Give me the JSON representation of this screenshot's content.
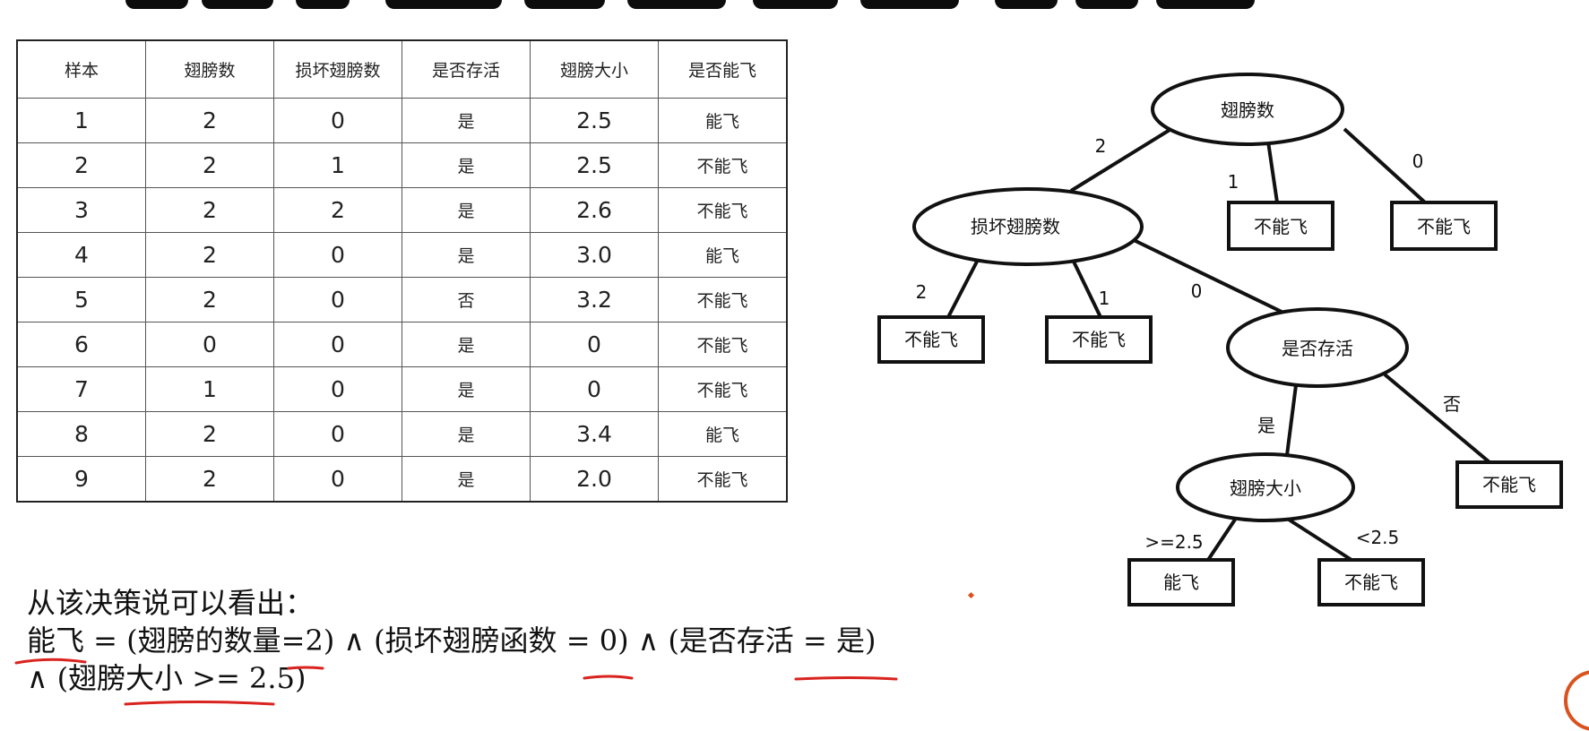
{
  "table": {
    "headers": [
      "样本",
      "翅膀数",
      "损坏翅膀数",
      "是否存活",
      "翅膀大小",
      "是否能飞"
    ],
    "rows": [
      [
        "1",
        "2",
        "0",
        "是",
        "2.5",
        "能飞"
      ],
      [
        "2",
        "2",
        "1",
        "是",
        "2.5",
        "不能飞"
      ],
      [
        "3",
        "2",
        "2",
        "是",
        "2.6",
        "不能飞"
      ],
      [
        "4",
        "2",
        "0",
        "是",
        "3.0",
        "能飞"
      ],
      [
        "5",
        "2",
        "0",
        "否",
        "3.2",
        "不能飞"
      ],
      [
        "6",
        "0",
        "0",
        "是",
        "0",
        "不能飞"
      ],
      [
        "7",
        "1",
        "0",
        "是",
        "0",
        "不能飞"
      ],
      [
        "8",
        "2",
        "0",
        "是",
        "3.4",
        "能飞"
      ],
      [
        "9",
        "2",
        "0",
        "是",
        "2.0",
        "不能飞"
      ]
    ]
  },
  "tree": {
    "nodes": {
      "root": "翅膀数",
      "damaged": "损坏翅膀数",
      "survived": "是否存活",
      "wing_size": "翅膀大小"
    },
    "leaves": {
      "wings_1": "不能飞",
      "wings_0": "不能飞",
      "damaged_2": "不能飞",
      "damaged_1": "不能飞",
      "survived_no": "不能飞",
      "size_ge": "能飞",
      "size_lt": "不能飞"
    },
    "edges": {
      "root_2": "2",
      "root_1": "1",
      "root_0": "0",
      "damaged_2": "2",
      "damaged_1": "1",
      "damaged_0": "0",
      "survived_yes": "是",
      "survived_no": "否",
      "size_ge": ">=2.5",
      "size_lt": "<2.5"
    }
  },
  "conclusion": {
    "line1": "从该决策说可以看出：",
    "line2": "能飞 = (翅膀的数量=2) ∧ (损坏翅膀函数 = 0) ∧ (是否存活 = 是)",
    "line3": "∧ (翅膀大小 >= 2.5)"
  },
  "colors": {
    "annotation": "#d9231e",
    "corner_accent": "#d9531e"
  }
}
